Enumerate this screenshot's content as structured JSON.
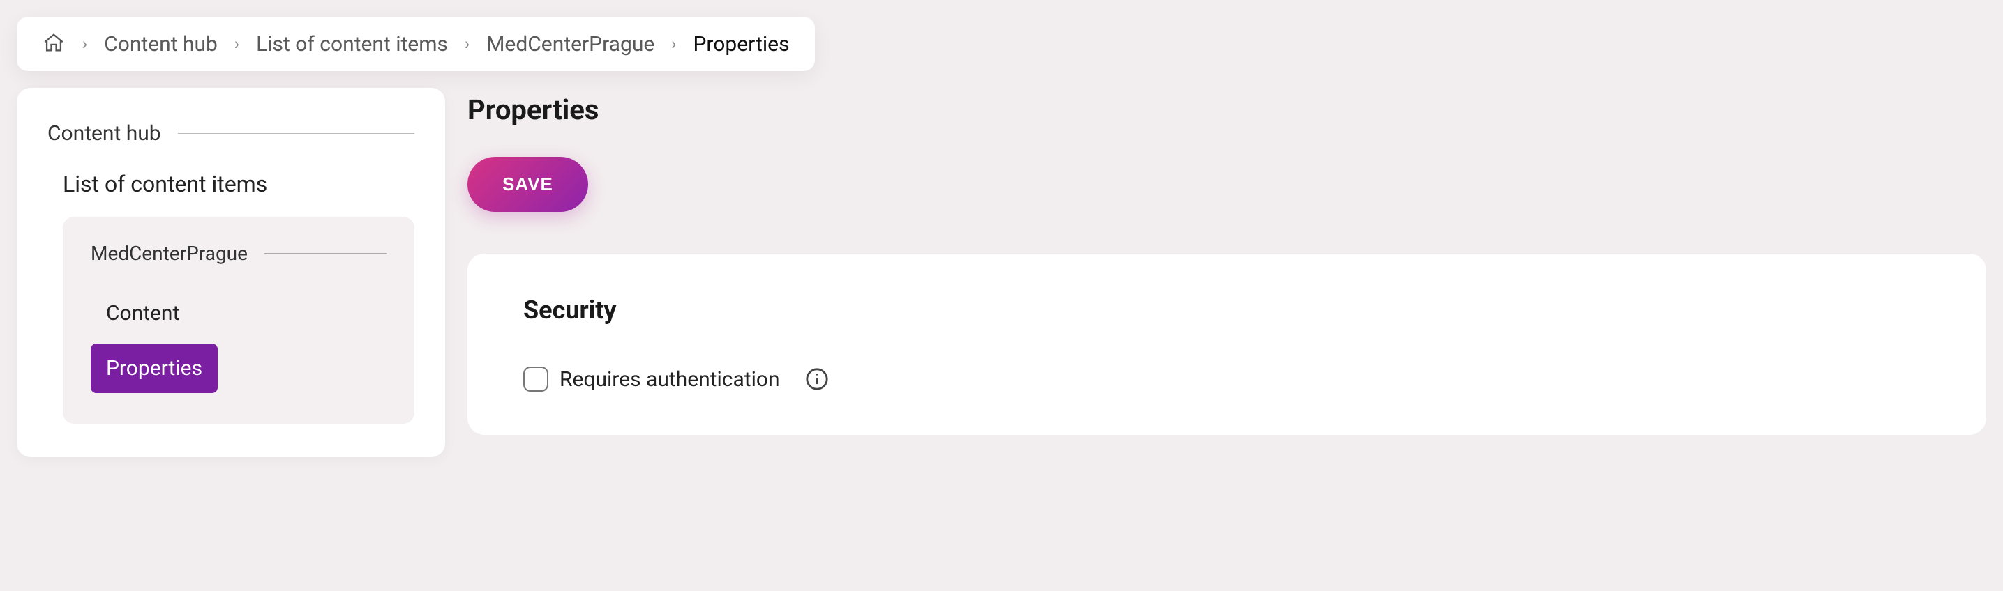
{
  "breadcrumb": {
    "items": [
      {
        "label": "Content hub"
      },
      {
        "label": "List of content items"
      },
      {
        "label": "MedCenterPrague"
      }
    ],
    "current": "Properties"
  },
  "sidebar": {
    "section_title": "Content hub",
    "list_label": "List of content items",
    "item_title": "MedCenterPrague",
    "nested_items": [
      {
        "label": "Content",
        "active": false
      },
      {
        "label": "Properties",
        "active": true
      }
    ]
  },
  "main": {
    "page_title": "Properties",
    "save_label": "SAVE",
    "security_card": {
      "title": "Security",
      "requires_auth_label": "Requires authentication",
      "requires_auth_checked": false
    }
  },
  "colors": {
    "accent_purple": "#7b1fa2",
    "gradient_start": "#d63384",
    "gradient_end": "#8e24aa",
    "background": "#f2edee"
  }
}
